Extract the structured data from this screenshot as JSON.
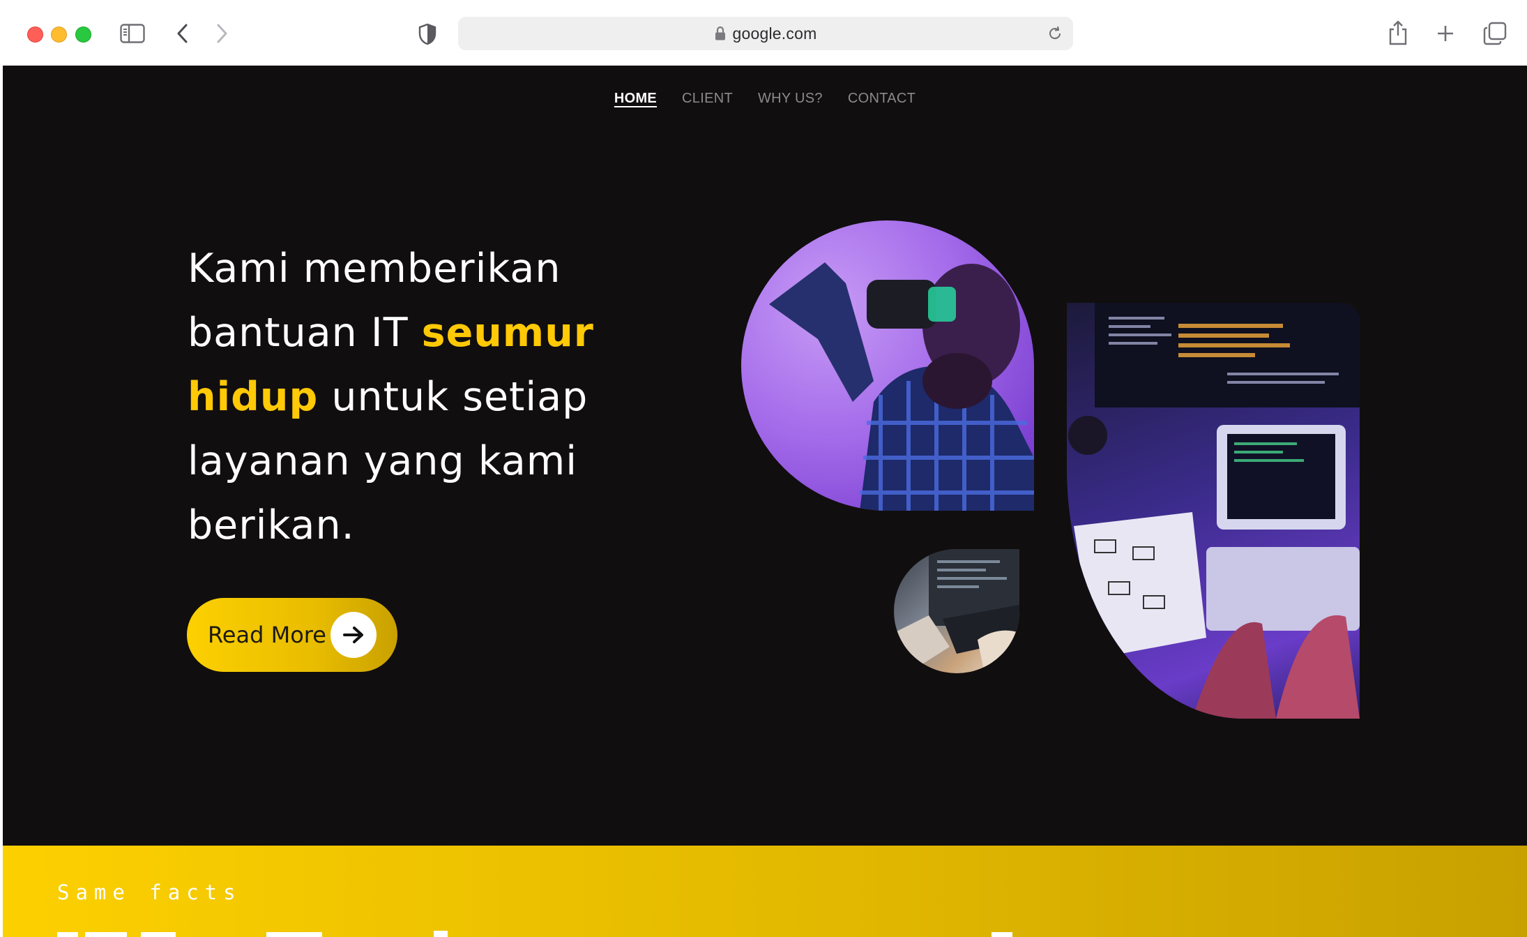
{
  "browser": {
    "url": "google.com"
  },
  "nav": {
    "items": [
      {
        "label": "HOME",
        "active": true
      },
      {
        "label": "CLIENT",
        "active": false
      },
      {
        "label": "WHY US?",
        "active": false
      },
      {
        "label": "CONTACT",
        "active": false
      }
    ]
  },
  "hero": {
    "line1": "Kami memberikan",
    "line2_pre": "bantuan IT ",
    "line2_hl": "seumur",
    "line3_hl": "hidup",
    "line3_post": " untuk setiap",
    "line4": "layanan yang kami",
    "line5": "berikan.",
    "cta_label": "Read More",
    "highlight_color": "#ffc906"
  },
  "facts": {
    "label": "Same facts"
  },
  "colors": {
    "background": "#110e0f",
    "accent_yellow": "#fcd000"
  }
}
